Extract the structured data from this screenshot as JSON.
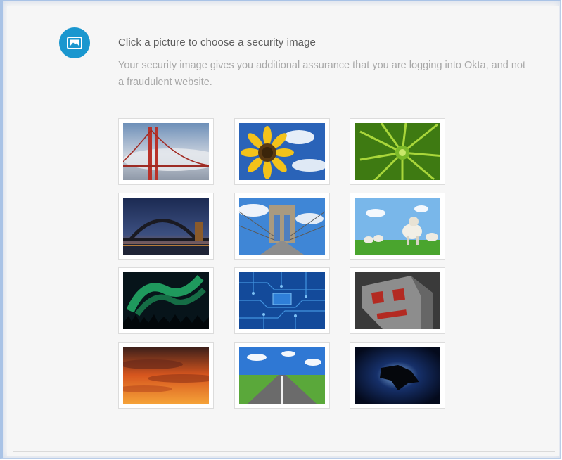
{
  "header": {
    "title": "Click a picture to choose a security image",
    "description": "Your security image gives you additional assurance that you are logging into Okta, and not a fraudulent website."
  },
  "icons": {
    "badge": "image-icon"
  },
  "colors": {
    "accent": "#1a97cf",
    "title_text": "#5d5d5d",
    "description_text": "#a8a8a8",
    "background": "#f6f6f6"
  },
  "images": [
    {
      "subject": "golden-gate-bridge"
    },
    {
      "subject": "sunflower"
    },
    {
      "subject": "succulent-plant"
    },
    {
      "subject": "harbour-bridge-night"
    },
    {
      "subject": "brooklyn-bridge"
    },
    {
      "subject": "sheep-on-grass"
    },
    {
      "subject": "aurora-borealis"
    },
    {
      "subject": "circuit-board"
    },
    {
      "subject": "robot-face"
    },
    {
      "subject": "orange-sunset-clouds"
    },
    {
      "subject": "open-road"
    },
    {
      "subject": "dark-space-shape"
    }
  ]
}
